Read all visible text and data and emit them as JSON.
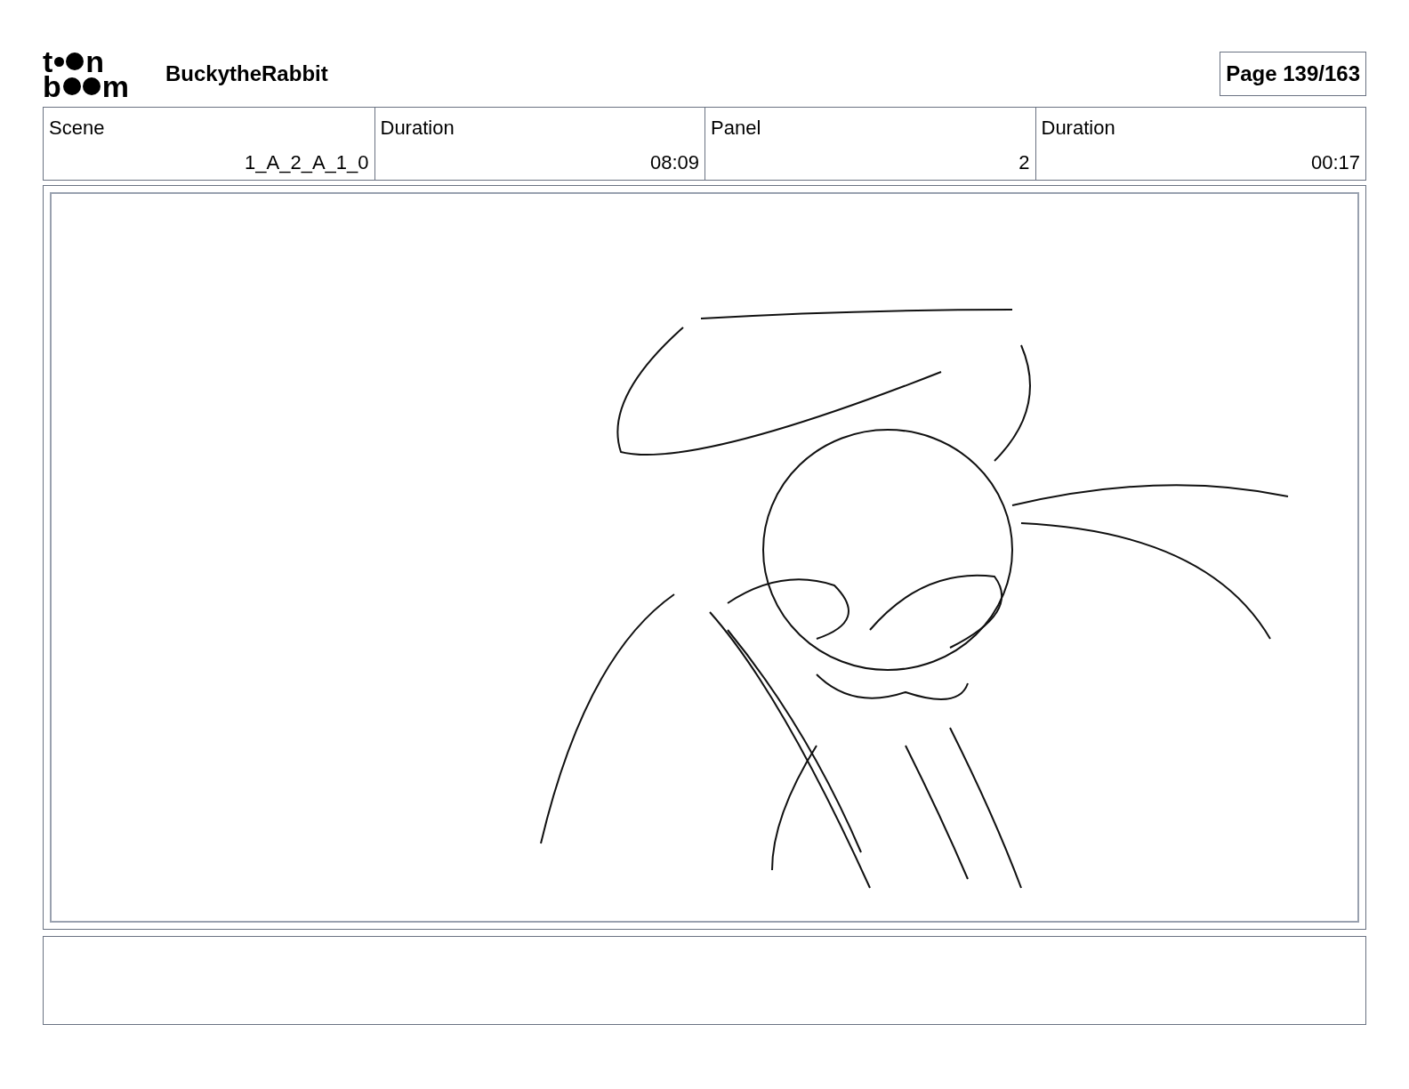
{
  "logo": {
    "lines": [
      [
        "t",
        "n"
      ],
      [
        "b",
        "m"
      ]
    ]
  },
  "project_title": "BuckytheRabbit",
  "page_label": "Page 139/163",
  "info_table": {
    "columns": [
      "Scene",
      "Duration",
      "Panel",
      "Duration"
    ],
    "row": [
      "1_A_2_A_1_0",
      "08:09",
      "2",
      "00:17"
    ]
  }
}
